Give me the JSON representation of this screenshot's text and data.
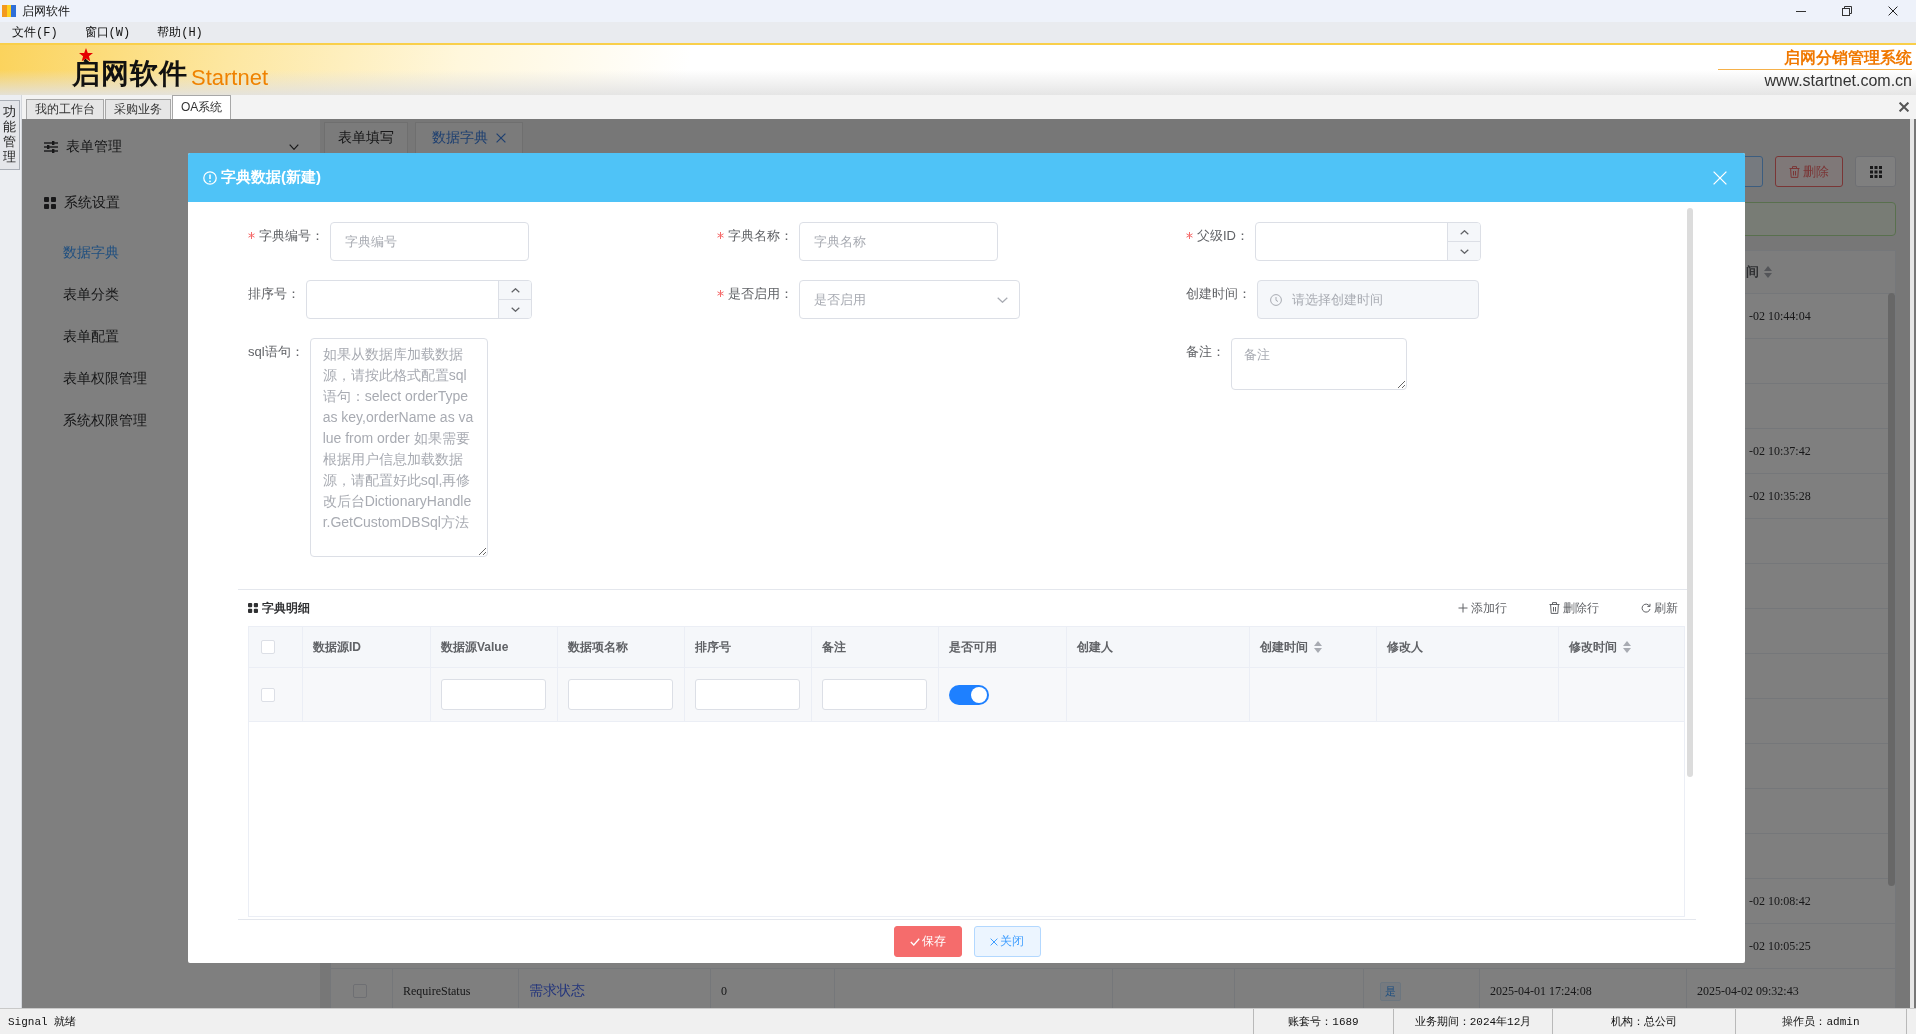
{
  "window": {
    "title": "启网软件"
  },
  "menu": [
    "文件(F)",
    "窗口(W)",
    "帮助(H)"
  ],
  "banner": {
    "logo": "启网软件",
    "logo_latin": "Startnet",
    "system_name": "启网分销管理系统",
    "website": "www.startnet.com.cn"
  },
  "side_tab": "功能管理",
  "module_tabs": [
    {
      "label": "我的工作台",
      "selected": false
    },
    {
      "label": "采购业务",
      "selected": false
    },
    {
      "label": "OA系统",
      "selected": true
    }
  ],
  "sidebar": {
    "groups": [
      {
        "label": "表单管理",
        "kind": "sliders",
        "expanded": false
      },
      {
        "label": "系统设置",
        "kind": "grid",
        "expanded": true,
        "children": [
          {
            "label": "数据字典",
            "selected": true
          },
          {
            "label": "表单分类",
            "selected": false
          },
          {
            "label": "表单配置",
            "selected": false
          },
          {
            "label": "表单权限管理",
            "selected": false
          },
          {
            "label": "系统权限管理",
            "selected": false
          }
        ]
      }
    ]
  },
  "content_tabs": [
    {
      "label": "表单填写",
      "selected": false,
      "closable": false
    },
    {
      "label": "数据字典",
      "selected": true,
      "closable": true
    }
  ],
  "toolbar": [
    {
      "kind": "cut"
    },
    {
      "kind": "danger",
      "label": "删除"
    },
    {
      "kind": "icon"
    }
  ],
  "list": {
    "last_column_header": "间",
    "rows": [
      {
        "kind": "cut",
        "column_10": "-02 10:44:04"
      },
      {
        "kind": "blank"
      },
      {
        "kind": "blank"
      },
      {
        "kind": "cut",
        "column_10": "-02 10:37:42"
      },
      {
        "kind": "cut",
        "column_10": "-02 10:35:28"
      },
      {
        "kind": "blank"
      },
      {
        "kind": "blank"
      },
      {
        "kind": "blank"
      },
      {
        "kind": "blank"
      },
      {
        "kind": "blank"
      },
      {
        "kind": "blank"
      },
      {
        "kind": "blank"
      },
      {
        "kind": "blank"
      },
      {
        "kind": "cut",
        "column_10": "-02 10:08:42"
      },
      {
        "kind": "cut",
        "column_10": "-02 10:05:25"
      },
      {
        "kind": "full",
        "checked": false,
        "column_2": "RequireStatus",
        "column_3": "需求状态",
        "column_4": "0",
        "column_8": "是",
        "column_9": "2025-04-01 17:24:08",
        "column_10": "2025-04-02 09:32:43"
      }
    ]
  },
  "dialog": {
    "title": "字典数据(新建)",
    "form_rows": [
      [
        {
          "label": "字典编号：",
          "required": true,
          "kind": "text",
          "placeholder": "字典编号"
        },
        {
          "label": "字典名称：",
          "required": true,
          "kind": "text",
          "placeholder": "字典名称"
        },
        {
          "label": "父级ID：",
          "required": true,
          "kind": "number"
        }
      ],
      [
        {
          "label": "排序号：",
          "required": false,
          "kind": "number"
        },
        {
          "label": "是否启用：",
          "required": true,
          "kind": "select",
          "placeholder": "是否启用"
        },
        {
          "label": "创建时间：",
          "required": false,
          "kind": "date",
          "placeholder": "请选择创建时间"
        }
      ],
      [
        {
          "label": "sql语句：",
          "required": false,
          "kind": "textarea",
          "placeholder": "如果从数据库加载数据源，请按此格式配置sql语句：select orderType as key,orderName as value from order 如果需要根据用户信息加载数据源，请配置好此sql,再修改后台DictionaryHandler.GetCustomDBSql方法"
        },
        {
          "label": "备注：",
          "required": false,
          "kind": "textarea",
          "placeholder": "备注"
        }
      ]
    ],
    "detail": {
      "title": "字典明细",
      "actions": [
        {
          "kind": "add",
          "label": "添加行"
        },
        {
          "kind": "delete",
          "label": "删除行"
        },
        {
          "kind": "refresh",
          "label": "刷新"
        }
      ],
      "all_checked": false,
      "columns": [
        {
          "label": "数据源ID",
          "sortable": false
        },
        {
          "label": "数据源Value",
          "sortable": false
        },
        {
          "label": "数据项名称",
          "sortable": false
        },
        {
          "label": "排序号",
          "sortable": false
        },
        {
          "label": "备注",
          "sortable": false
        },
        {
          "label": "是否可用",
          "sortable": false
        },
        {
          "label": "创建人",
          "sortable": false
        },
        {
          "label": "创建时间",
          "sortable": true
        },
        {
          "label": "修改人",
          "sortable": false
        },
        {
          "label": "修改时间",
          "sortable": true
        }
      ],
      "rows": [
        {
          "checked": false,
          "cells": [
            {
              "kind": "empty"
            },
            {
              "kind": "input"
            },
            {
              "kind": "input"
            },
            {
              "kind": "input"
            },
            {
              "kind": "input"
            },
            {
              "kind": "switch",
              "on": true
            },
            {
              "kind": "empty"
            },
            {
              "kind": "empty"
            },
            {
              "kind": "empty"
            },
            {
              "kind": "empty"
            }
          ]
        }
      ]
    },
    "buttons": [
      {
        "kind": "primary",
        "label": "保存"
      },
      {
        "kind": "default",
        "label": "关闭"
      }
    ]
  },
  "status_bar": {
    "message": "Signal 就绪",
    "fields": [
      "账套号：1689",
      "业务期间：2024年12月",
      "机构：总公司",
      "操作员：admin"
    ]
  }
}
